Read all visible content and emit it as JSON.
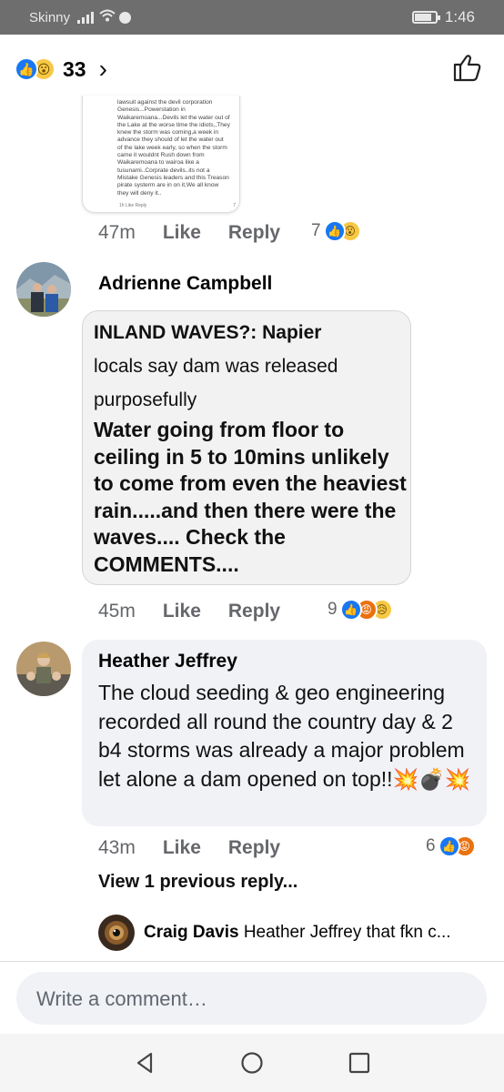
{
  "status_bar": {
    "carrier": "Skinny",
    "time": "1:46"
  },
  "header": {
    "reaction_count": "33",
    "chevron": "›"
  },
  "embedded_comment": {
    "text_lines": [
      "lawsuit against the devil corporation",
      "Genesis...Powerstation in",
      "Waikaremoana...Devils let the water out of",
      "the Lake at the worse time the idiots,,They",
      "knew the storm was coming,a week in",
      "advance they should of let the water out",
      "of the lake week early, so when the storm",
      "came it wouldnt Rush down from",
      "Waikaremoana to wairoa like a",
      "tusunami..Corprate devils..its not a",
      "Mistake Genesis leaders and this Treason",
      "pirate systerm are in on it,We all know",
      "they will deny it.."
    ],
    "meta": "1h   Like   Reply",
    "count": "7"
  },
  "comment0_actions": {
    "time": "47m",
    "like": "Like",
    "reply": "Reply",
    "count": "7"
  },
  "comment1": {
    "author": "Adrienne Campbell",
    "image_title": "INLAND WAVES?: Napier",
    "image_line2": "locals say dam was released",
    "image_line3": "purposefully",
    "image_body": "Water going from floor to ceiling in 5 to 10mins unlikely to come from even the heaviest rain.....and then there were the waves.... Check the COMMENTS....",
    "time": "45m",
    "like": "Like",
    "reply": "Reply",
    "count": "9"
  },
  "comment2": {
    "author": "Heather Jeffrey",
    "text": "The cloud seeding & geo engineering recorded all round the country day & 2 b4 storms was already a major problem let alone a dam opened on top!!💥💣💥",
    "time": "43m",
    "like": "Like",
    "reply": "Reply",
    "count": "6"
  },
  "replies": {
    "view_previous": "View 1 previous reply...",
    "author": "Craig Davis",
    "text": "Heather Jeffrey that fkn c..."
  },
  "composer": {
    "placeholder": "Write a comment…"
  },
  "icons": {
    "like": "like-reaction-icon",
    "wow": "wow-reaction-icon",
    "angry": "angry-reaction-icon",
    "sad": "sad-reaction-icon",
    "thumb": "thumbs-up-outline-icon"
  },
  "colors": {
    "accent": "#1877f2",
    "bubble": "#f0f2f5",
    "status_bar": "#6e6e6e"
  }
}
